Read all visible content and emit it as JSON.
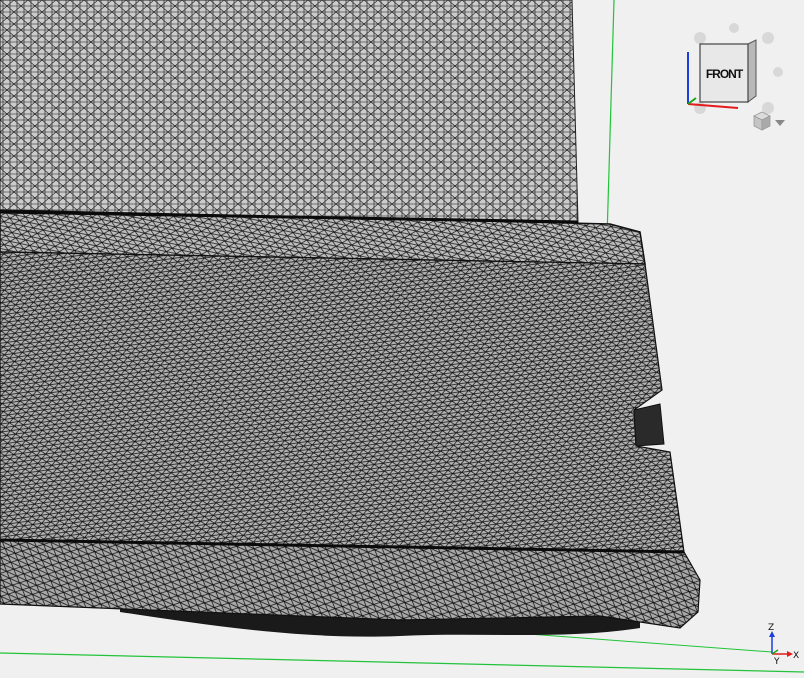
{
  "navigation_cube": {
    "face_label": "FRONT",
    "menu_icon": "cube-menu-icon",
    "rotate_arrow_icon": "rotate-arrow-icon"
  },
  "axis_indicator": {
    "z_label": "Z",
    "y_label": "Y",
    "x_label": "X"
  },
  "colors": {
    "background": "#f0f0f0",
    "mesh_fill": "#c8c8c8",
    "mesh_lines": "#1a1a1a",
    "grid_line": "#22c33a",
    "axis_x": "#e31b1b",
    "axis_y": "#1aa51a",
    "axis_z": "#1b3ee3"
  }
}
